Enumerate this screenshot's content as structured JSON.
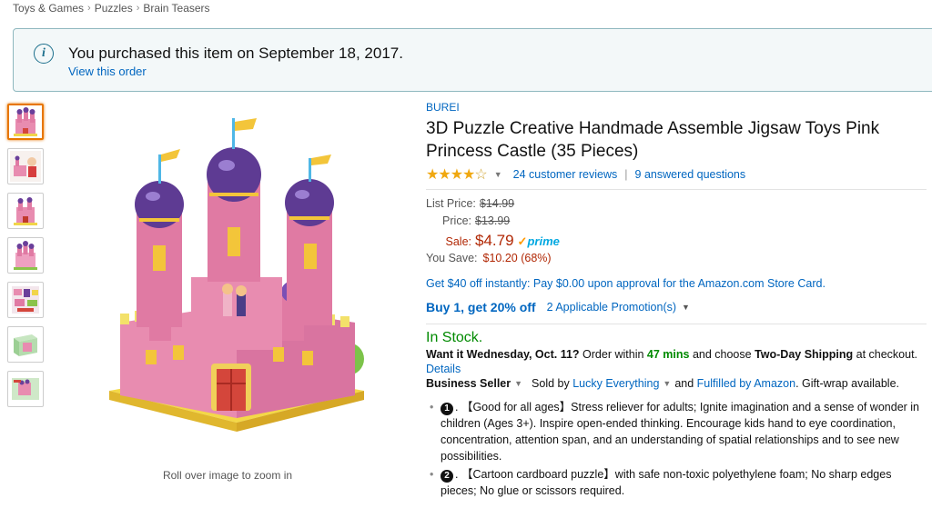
{
  "breadcrumb": [
    "Toys & Games",
    "Puzzles",
    "Brain Teasers"
  ],
  "notice": {
    "message": "You purchased this item on September 18, 2017.",
    "link": "View this order"
  },
  "thumbnails_count": 7,
  "zoom_hint": "Roll over image to zoom in",
  "product": {
    "brand": "BUREI",
    "title": "3D Puzzle Creative Handmade Assemble Jigsaw Toys Pink Princess Castle (35 Pieces)",
    "rating": 4.0,
    "reviews": "24 customer reviews",
    "questions": "9 answered questions"
  },
  "pricing": {
    "list_label": "List Price:",
    "list_value": "$14.99",
    "price_label": "Price:",
    "price_value": "$13.99",
    "sale_label": "Sale:",
    "sale_value": "$4.79",
    "prime_label": "prime",
    "save_label": "You Save:",
    "save_value": "$10.20 (68%)"
  },
  "store_card": "Get $40 off instantly: Pay $0.00 upon approval for the Amazon.com Store Card.",
  "promo": {
    "main": "Buy 1, get 20% off",
    "link": "2 Applicable Promotion(s)"
  },
  "availability": {
    "status": "In Stock.",
    "want_it": "Want it Wednesday, Oct. 11?",
    "order_within": " Order within ",
    "time_left": "47 mins",
    "and_choose": " and choose ",
    "shipping": "Two-Day Shipping",
    "at_checkout": " at checkout.",
    "details": "Details"
  },
  "seller": {
    "badge": "Business Seller",
    "sold_by": "Sold by ",
    "seller_name": "Lucky Everything",
    "and": " and ",
    "fulfilled": "Fulfilled by Amazon",
    "gift": ". Gift-wrap available."
  },
  "bullets": [
    {
      "num": "1",
      "heading": ". 【Good for all ages】",
      "text": "Stress reliever for adults; Ignite imagination and a sense of wonder in children (Ages 3+). Inspire open-ended thinking. Encourage kids hand to eye coordination, concentration, attention span, and an understanding of spatial relationships and to see new possibilities."
    },
    {
      "num": "2",
      "heading": ". 【Cartoon cardboard puzzle】",
      "text": "with safe non-toxic polyethylene foam; No sharp edges pieces; No glue or scissors required."
    }
  ],
  "colors": {
    "link": "#0066c0",
    "price": "#b12704",
    "stock": "#008a00",
    "star": "#f0a810",
    "thumb_active": "#e77600"
  }
}
